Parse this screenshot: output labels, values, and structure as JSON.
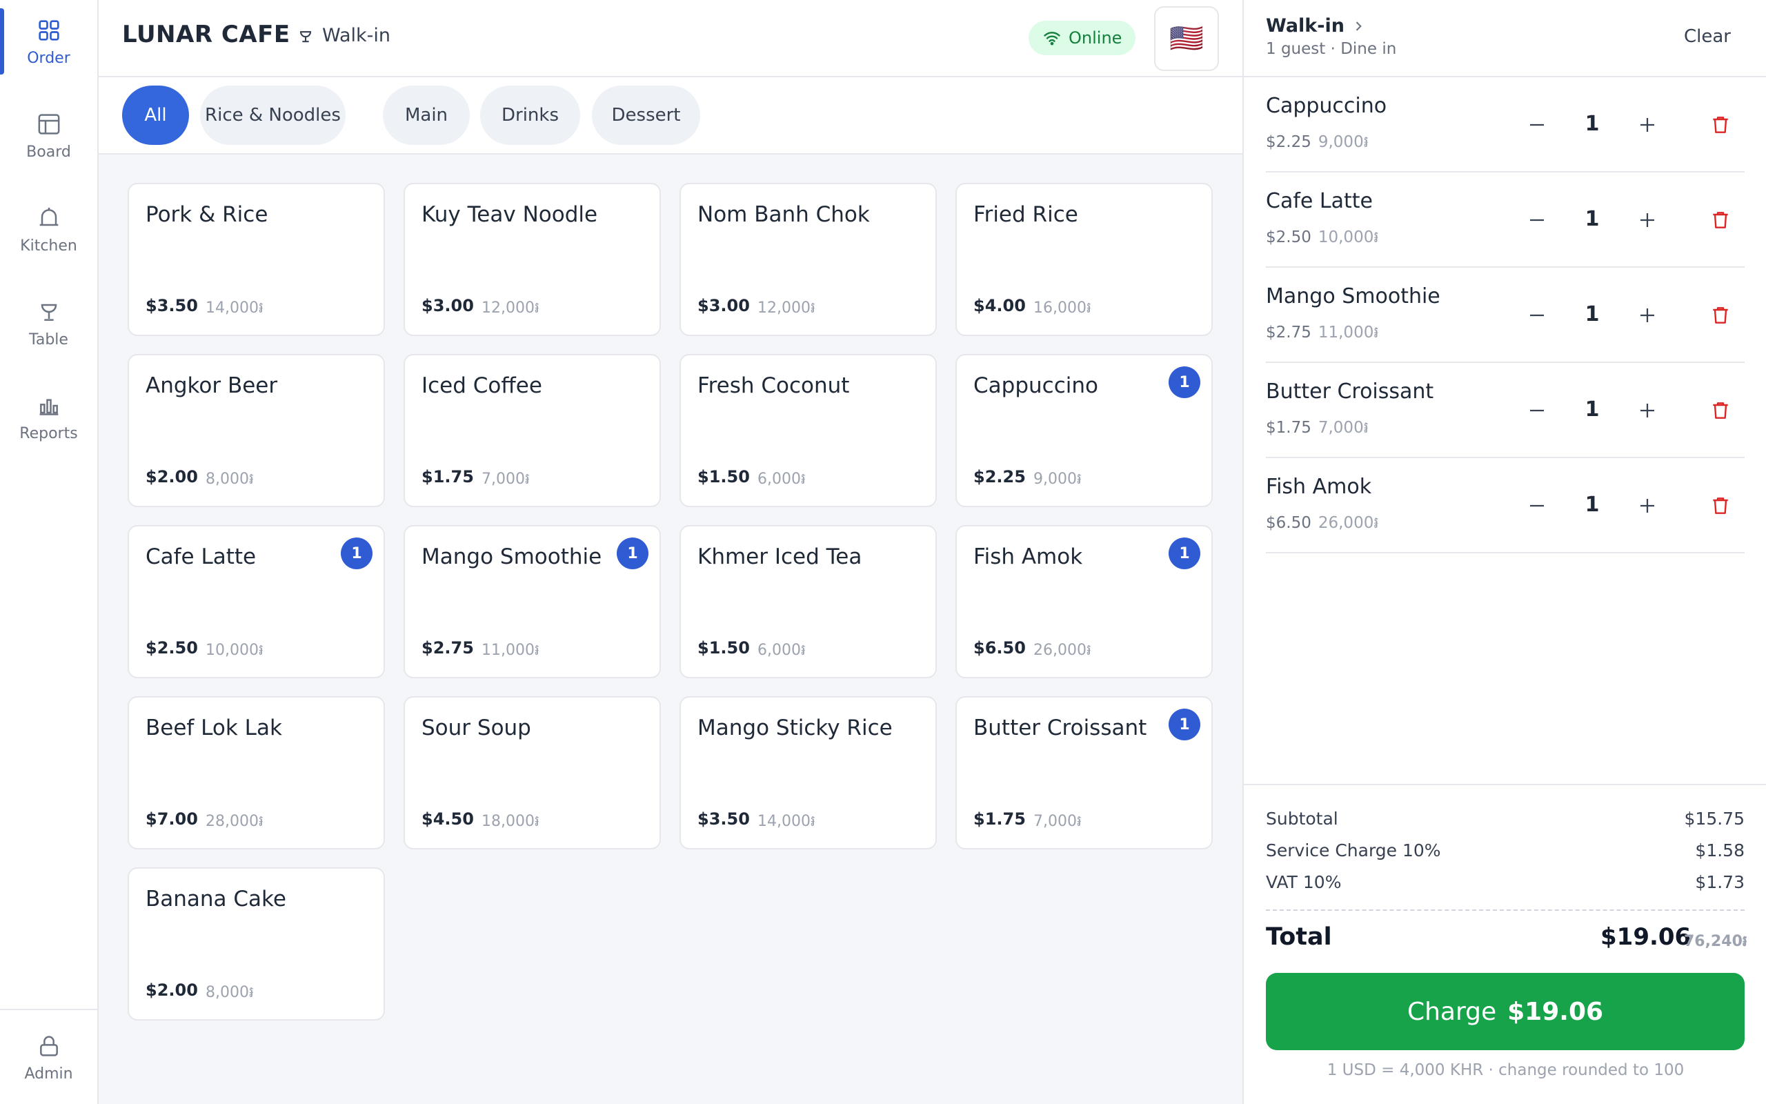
{
  "sidebar": {
    "items": [
      {
        "label": "Order"
      },
      {
        "label": "Board"
      },
      {
        "label": "Kitchen"
      },
      {
        "label": "Table"
      },
      {
        "label": "Reports"
      }
    ],
    "admin": "Admin"
  },
  "header": {
    "brand": "LUNAR CAFE",
    "table": "Walk-in",
    "status": "Online",
    "flag": "🇺🇸"
  },
  "categories": [
    "All",
    "Rice & Noodles",
    "Main",
    "Drinks",
    "Dessert"
  ],
  "products": [
    {
      "name": "Pork & Rice",
      "price": "$3.50",
      "khr": "14,000៛",
      "qty": ""
    },
    {
      "name": "Kuy Teav Noodle",
      "price": "$3.00",
      "khr": "12,000៛",
      "qty": ""
    },
    {
      "name": "Nom Banh Chok",
      "price": "$3.00",
      "khr": "12,000៛",
      "qty": ""
    },
    {
      "name": "Fried Rice",
      "price": "$4.00",
      "khr": "16,000៛",
      "qty": ""
    },
    {
      "name": "Angkor Beer",
      "price": "$2.00",
      "khr": "8,000៛",
      "qty": ""
    },
    {
      "name": "Iced Coffee",
      "price": "$1.75",
      "khr": "7,000៛",
      "qty": ""
    },
    {
      "name": "Fresh Coconut",
      "price": "$1.50",
      "khr": "6,000៛",
      "qty": ""
    },
    {
      "name": "Cappuccino",
      "price": "$2.25",
      "khr": "9,000៛",
      "qty": "1"
    },
    {
      "name": "Cafe Latte",
      "price": "$2.50",
      "khr": "10,000៛",
      "qty": "1"
    },
    {
      "name": "Mango Smoothie",
      "price": "$2.75",
      "khr": "11,000៛",
      "qty": "1"
    },
    {
      "name": "Khmer Iced Tea",
      "price": "$1.50",
      "khr": "6,000៛",
      "qty": ""
    },
    {
      "name": "Fish Amok",
      "price": "$6.50",
      "khr": "26,000៛",
      "qty": "1"
    },
    {
      "name": "Beef Lok Lak",
      "price": "$7.00",
      "khr": "28,000៛",
      "qty": ""
    },
    {
      "name": "Sour Soup",
      "price": "$4.50",
      "khr": "18,000៛",
      "qty": ""
    },
    {
      "name": "Mango Sticky Rice",
      "price": "$3.50",
      "khr": "14,000៛",
      "qty": ""
    },
    {
      "name": "Butter Croissant",
      "price": "$1.75",
      "khr": "7,000៛",
      "qty": "1"
    },
    {
      "name": "Banana Cake",
      "price": "$2.00",
      "khr": "8,000៛",
      "qty": ""
    }
  ],
  "order": {
    "title": "Walk-in",
    "subtitle": "1 guest · Dine in",
    "clear": "Clear",
    "lines": [
      {
        "name": "Cappuccino",
        "price": "$2.25",
        "khr": "9,000៛",
        "qty": "1"
      },
      {
        "name": "Cafe Latte",
        "price": "$2.50",
        "khr": "10,000៛",
        "qty": "1"
      },
      {
        "name": "Mango Smoothie",
        "price": "$2.75",
        "khr": "11,000៛",
        "qty": "1"
      },
      {
        "name": "Butter Croissant",
        "price": "$1.75",
        "khr": "7,000៛",
        "qty": "1"
      },
      {
        "name": "Fish Amok",
        "price": "$6.50",
        "khr": "26,000៛",
        "qty": "1"
      }
    ],
    "summary": {
      "subtotal_label": "Subtotal",
      "subtotal": "$15.75",
      "service_label": "Service Charge 10%",
      "service": "$1.58",
      "vat_label": "VAT 10%",
      "vat": "$1.73",
      "total_label": "Total",
      "total": "$19.06",
      "total_khr": "76,240៛"
    },
    "charge_label": "Charge",
    "charge_amount": "$19.06",
    "rate_note": "1 USD = 4,000 KHR · change rounded to 100"
  },
  "colors": {
    "accent": "#2f5bd3",
    "charge": "#16a34a",
    "online_bg": "#dcfce7",
    "delete": "#dc2626"
  }
}
